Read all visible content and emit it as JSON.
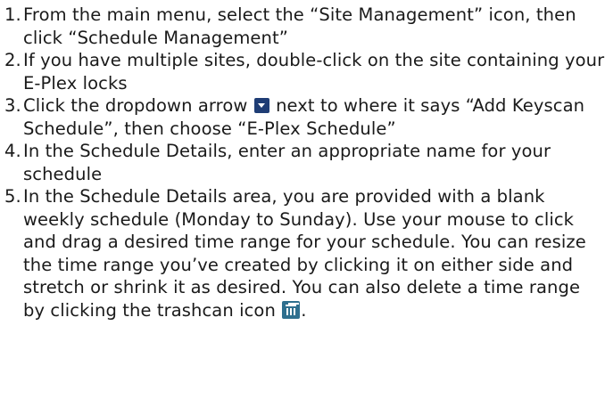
{
  "steps": [
    {
      "num": "1.",
      "text": "From the main menu, select the “Site Management” icon, then click “Schedule Management”"
    },
    {
      "num": "2.",
      "text": "If you have multiple sites, double-click on the site containing your E-Plex locks"
    },
    {
      "num": "3.",
      "text_before": "Click the dropdown arrow",
      "text_after": " next to where it says “Add Keyscan Schedule”, then choose “E-Plex Schedule”"
    },
    {
      "num": "4.",
      "text": "In the Schedule Details, enter an appropriate name for your schedule"
    },
    {
      "num": "5.",
      "text_before": "In the Schedule Details area, you are provided with a blank weekly schedule (Monday to Sunday).  Use your mouse to click and drag a desired time range for your schedule.  You can resize the time range you’ve created by clicking it on either side and stretch or shrink it as desired.  You can also delete a time range by clicking the trashcan icon",
      "text_after": "."
    }
  ],
  "icons": {
    "dropdown_arrow": "dropdown-arrow-icon",
    "trashcan": "trashcan-icon"
  },
  "colors": {
    "dropdown_icon_bg": "#1f3d75",
    "trash_icon_bg": "#2e6f8e"
  }
}
